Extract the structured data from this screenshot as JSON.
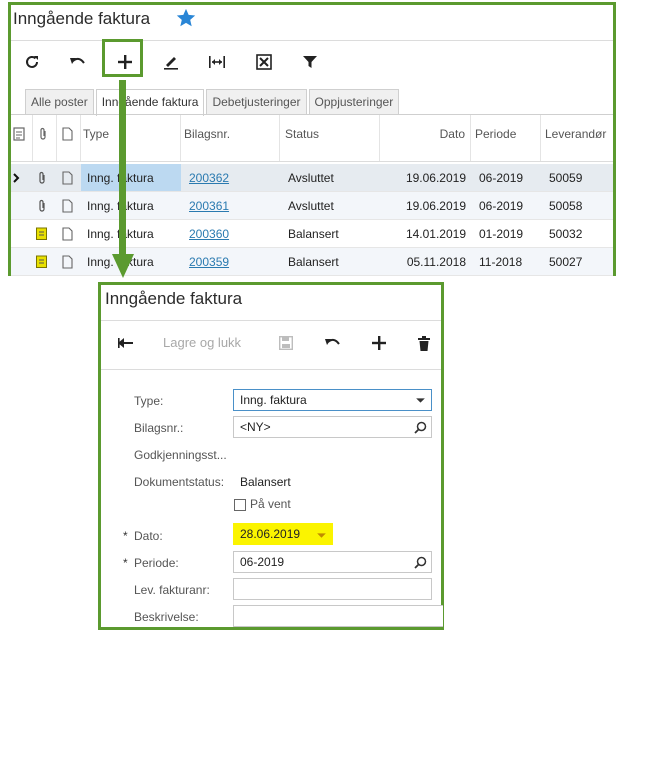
{
  "list_screen": {
    "title": "Inngående faktura",
    "toolbar": [
      "refresh-icon",
      "undo-icon",
      "add-icon",
      "edit-icon",
      "fit-columns-icon",
      "export-excel-icon",
      "filter-icon"
    ],
    "tabs": [
      {
        "label": "Alle poster",
        "active": false
      },
      {
        "label": "Inngående faktura",
        "active": true
      },
      {
        "label": "Debetjusteringer",
        "active": false
      },
      {
        "label": "Oppjusteringer",
        "active": false
      }
    ],
    "columns": {
      "type": "Type",
      "ref": "Bilagsnr.",
      "status": "Status",
      "date": "Dato",
      "period": "Periode",
      "vendor": "Leverandør"
    },
    "rows": [
      {
        "type": "Inng. faktura",
        "ref": "200362",
        "status": "Avsluttet",
        "date": "19.06.2019",
        "period": "06-2019",
        "vendor": "50059"
      },
      {
        "type": "Inng. faktura",
        "ref": "200361",
        "status": "Avsluttet",
        "date": "19.06.2019",
        "period": "06-2019",
        "vendor": "50058"
      },
      {
        "type": "Inng. faktura",
        "ref": "200360",
        "status": "Balansert",
        "date": "14.01.2019",
        "period": "01-2019",
        "vendor": "50032"
      },
      {
        "type": "Inng. faktura",
        "ref": "200359",
        "status": "Balansert",
        "date": "05.11.2018",
        "period": "11-2018",
        "vendor": "50027"
      }
    ]
  },
  "form_screen": {
    "title": "Inngående faktura",
    "toolbar": {
      "save_close": "Lagre og lukk"
    },
    "labels": {
      "type": "Type:",
      "ref": "Bilagsnr.:",
      "approval": "Godkjenningsst...",
      "doc_status": "Dokumentstatus:",
      "on_hold": "På vent",
      "date": "Dato:",
      "period": "Periode:",
      "vendor_invoice": "Lev. fakturanr:",
      "description": "Beskrivelse:"
    },
    "required_mark": "*",
    "values": {
      "type": "Inng. faktura",
      "ref": "<NY>",
      "doc_status": "Balansert",
      "date": "28.06.2019",
      "period": "06-2019",
      "vendor_invoice": "",
      "description": ""
    }
  },
  "colors": {
    "highlight_border": "#5b9a2f",
    "link": "#2a7ab0",
    "date_highlight": "#fbf400",
    "star": "#2a86d6"
  }
}
